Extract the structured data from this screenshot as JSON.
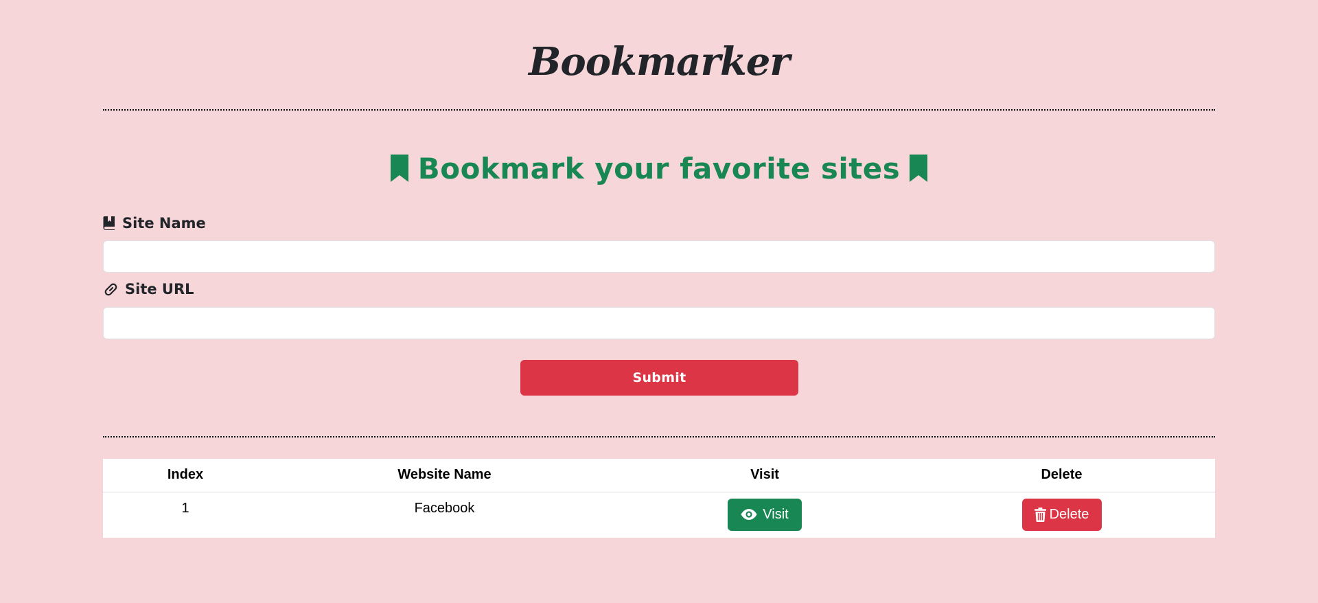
{
  "header": {
    "brand": "Bookmarker"
  },
  "form": {
    "heading": "Bookmark your favorite sites",
    "site_name_label": "Site Name",
    "site_name_value": "",
    "site_url_label": "Site URL",
    "site_url_value": "",
    "submit_label": "Submit"
  },
  "icons": {
    "heading_left": "bookmark-icon",
    "heading_right": "bookmark-icon",
    "site_name": "book-bookmark-icon",
    "site_url": "link-icon",
    "visit": "eye-icon",
    "delete": "trash-icon"
  },
  "table": {
    "headers": [
      "Index",
      "Website Name",
      "Visit",
      "Delete"
    ],
    "rows": [
      {
        "index": "1",
        "name": "Facebook",
        "visit_label": "Visit",
        "delete_label": "Delete"
      }
    ]
  },
  "colors": {
    "background": "#f7d6da",
    "accent_green": "#198754",
    "accent_red": "#dc3545"
  }
}
